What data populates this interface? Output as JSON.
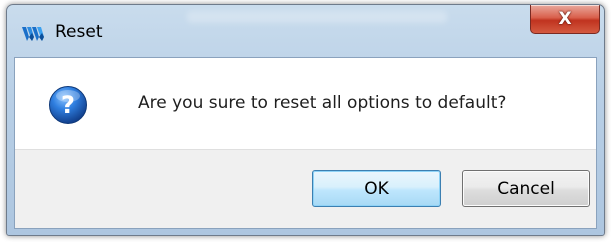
{
  "window": {
    "title": "Reset",
    "close_label": "X"
  },
  "dialog": {
    "message": "Are you sure to reset all options to default?",
    "icon": "question-icon"
  },
  "buttons": {
    "ok_label": "OK",
    "cancel_label": "Cancel"
  },
  "colors": {
    "titlebar": "#b8cfe6",
    "close_button": "#c0331f",
    "ok_button_border": "#3c7fb1",
    "question_icon": "#1f5fb8",
    "button_bar": "#f0f0f0"
  }
}
